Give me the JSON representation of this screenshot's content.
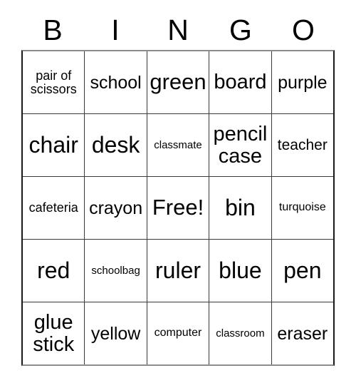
{
  "card": {
    "title": "BINGO",
    "header_letters": [
      "B",
      "I",
      "N",
      "G",
      "O"
    ],
    "columns": 5,
    "rows": 5,
    "free_space_label": "Free!",
    "free_space_position": "center",
    "colors": {
      "background": "#ffffff",
      "text": "#000000",
      "grid_line": "#3a3a3a",
      "border_horizontal": "#8c8c8c",
      "border_vertical": "#1a1a1a"
    },
    "grid": [
      [
        {
          "text": "pair of scissors",
          "size": "fs-xxs"
        },
        {
          "text": "school",
          "size": "fs-sm"
        },
        {
          "text": "green",
          "size": "fs-lg"
        },
        {
          "text": "board",
          "size": "fs-md"
        },
        {
          "text": "purple",
          "size": "fs-sm"
        }
      ],
      [
        {
          "text": "chair",
          "size": "fs-xl"
        },
        {
          "text": "desk",
          "size": "fs-xl"
        },
        {
          "text": "classmate",
          "size": "fs-mini"
        },
        {
          "text": "pencil case",
          "size": "fs-md"
        },
        {
          "text": "teacher",
          "size": "fs-xs"
        }
      ],
      [
        {
          "text": "cafeteria",
          "size": "fs-xxs"
        },
        {
          "text": "crayon",
          "size": "fs-sm"
        },
        {
          "text": "Free!",
          "size": "fs-lg"
        },
        {
          "text": "bin",
          "size": "fs-xl"
        },
        {
          "text": "turquoise",
          "size": "fs-tiny"
        }
      ],
      [
        {
          "text": "red",
          "size": "fs-xl"
        },
        {
          "text": "schoolbag",
          "size": "fs-mini"
        },
        {
          "text": "ruler",
          "size": "fs-xl"
        },
        {
          "text": "blue",
          "size": "fs-xl"
        },
        {
          "text": "pen",
          "size": "fs-xl"
        }
      ],
      [
        {
          "text": "glue stick",
          "size": "fs-md"
        },
        {
          "text": "yellow",
          "size": "fs-sm"
        },
        {
          "text": "computer",
          "size": "fs-tiny"
        },
        {
          "text": "classroom",
          "size": "fs-mini"
        },
        {
          "text": "eraser",
          "size": "fs-sm"
        }
      ]
    ]
  }
}
